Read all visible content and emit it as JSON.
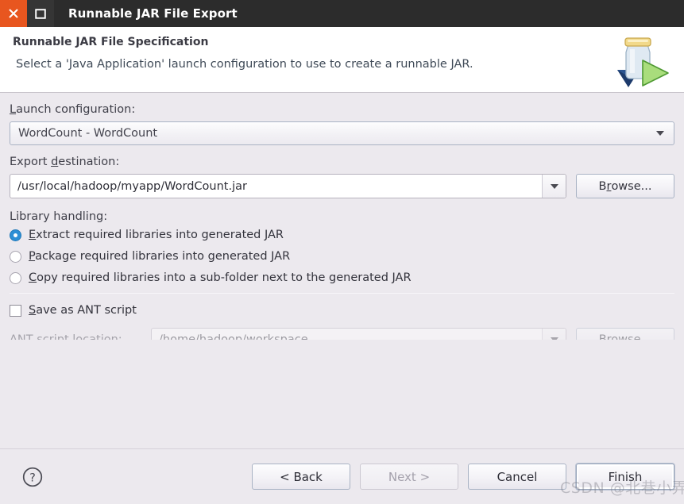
{
  "titlebar": {
    "title": "Runnable JAR File Export",
    "close_icon": "close-icon",
    "maximize_icon": "maximize-icon"
  },
  "header": {
    "title": "Runnable JAR File Specification",
    "subtitle": "Select a 'Java Application' launch configuration to use to create a runnable JAR.",
    "banner_icon": "jar-export-icon"
  },
  "form": {
    "launch_configuration": {
      "label_pre": "",
      "label_mnemonic": "L",
      "label_post": "aunch configuration:",
      "value": "WordCount - WordCount"
    },
    "export_destination": {
      "label_pre": "Export ",
      "label_mnemonic": "d",
      "label_post": "estination:",
      "value": "/usr/local/hadoop/myapp/WordCount.jar",
      "browse_pre": "B",
      "browse_mnemonic": "r",
      "browse_post": "owse..."
    },
    "library_handling": {
      "label": "Library handling:",
      "options": [
        {
          "mnemonic": "E",
          "text_post": "xtract required libraries into generated JAR",
          "selected": true
        },
        {
          "mnemonic": "P",
          "text_post": "ackage required libraries into generated JAR",
          "selected": false
        },
        {
          "mnemonic": "C",
          "text_post": "opy required libraries into a sub-folder next to the generated JAR",
          "selected": false
        }
      ]
    },
    "save_as_ant": {
      "mnemonic": "S",
      "text_post": "ave as ANT script",
      "checked": false
    },
    "ant_script_location": {
      "label": "ANT script location:",
      "value": "/home/hadoop/workspace",
      "browse_label": "Browse..."
    }
  },
  "footer": {
    "help_icon": "help-icon",
    "buttons": [
      {
        "label": "< Back",
        "state": "enabled"
      },
      {
        "label": "Next >",
        "state": "disabled"
      },
      {
        "label": "Cancel",
        "state": "enabled"
      },
      {
        "label": "Finish",
        "state": "default"
      }
    ]
  },
  "watermark": {
    "text": "CSDN @北巷小弄"
  },
  "colors": {
    "titlebar_bg": "#2c2c2c",
    "close_button": "#e8561f",
    "dialog_bg": "#ece9ee",
    "header_bg": "#ffffff",
    "radio_accent": "#2d8fd5"
  }
}
